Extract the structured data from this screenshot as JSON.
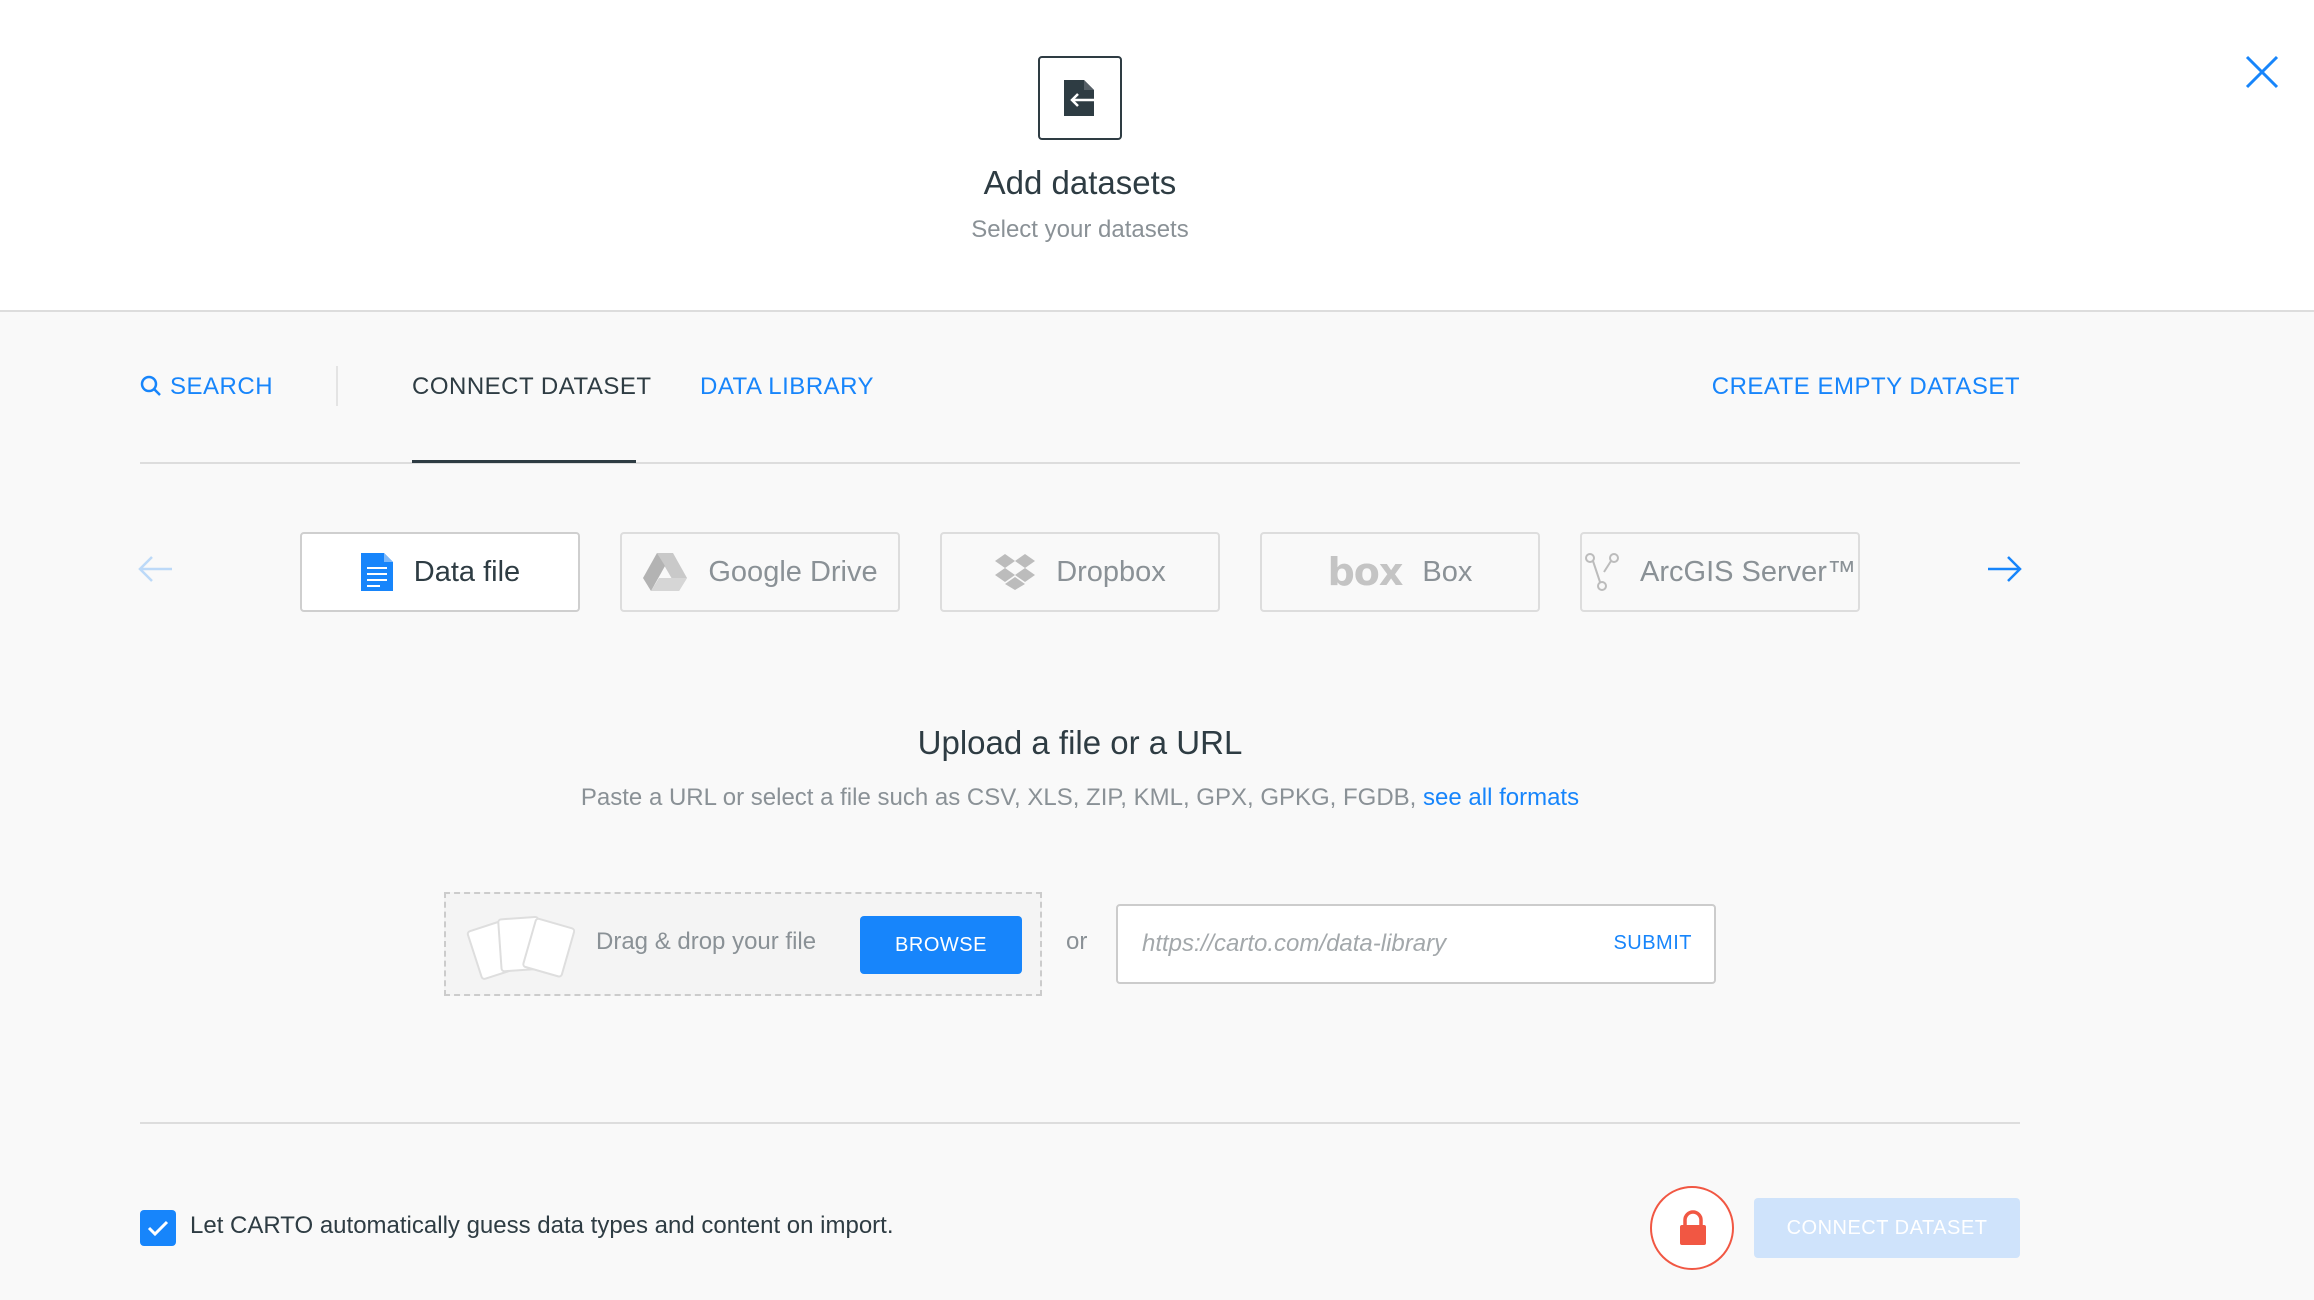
{
  "header": {
    "title": "Add datasets",
    "subtitle": "Select your datasets",
    "icon": "import-icon",
    "close_icon": "close-icon"
  },
  "tabs": {
    "search": "SEARCH",
    "connect": "CONNECT DATASET",
    "library": "DATA LIBRARY",
    "create": "CREATE EMPTY DATASET",
    "active": "connect"
  },
  "connectors": [
    {
      "label": "Data file",
      "icon": "document-icon",
      "active": true
    },
    {
      "label": "Google Drive",
      "icon": "google-drive-icon",
      "active": false
    },
    {
      "label": "Dropbox",
      "icon": "dropbox-icon",
      "active": false
    },
    {
      "label": "Box",
      "icon": "box-logo-icon",
      "logo_text": "box",
      "active": false
    },
    {
      "label": "ArcGIS Server™",
      "icon": "arcgis-icon",
      "active": false
    }
  ],
  "upload": {
    "title": "Upload a file or a URL",
    "description": "Paste a URL or select a file such as CSV, XLS, ZIP, KML, GPX, GPKG, FGDB,",
    "formats_link": "see all formats",
    "drop_text": "Drag & drop your file",
    "browse_label": "BROWSE",
    "or_text": "or",
    "url_placeholder": "https://carto.com/data-library",
    "url_value": "",
    "submit_label": "SUBMIT"
  },
  "footer": {
    "guess_label": "Let CARTO automatically guess data types and content on import.",
    "guess_checked": true,
    "connect_label": "CONNECT DATASET",
    "connect_enabled": false
  },
  "colors": {
    "accent": "#1785fb",
    "text": "#2e3c43",
    "muted": "#8a9196",
    "lock": "#f15743",
    "disabled_button": "#cfe3fb"
  }
}
